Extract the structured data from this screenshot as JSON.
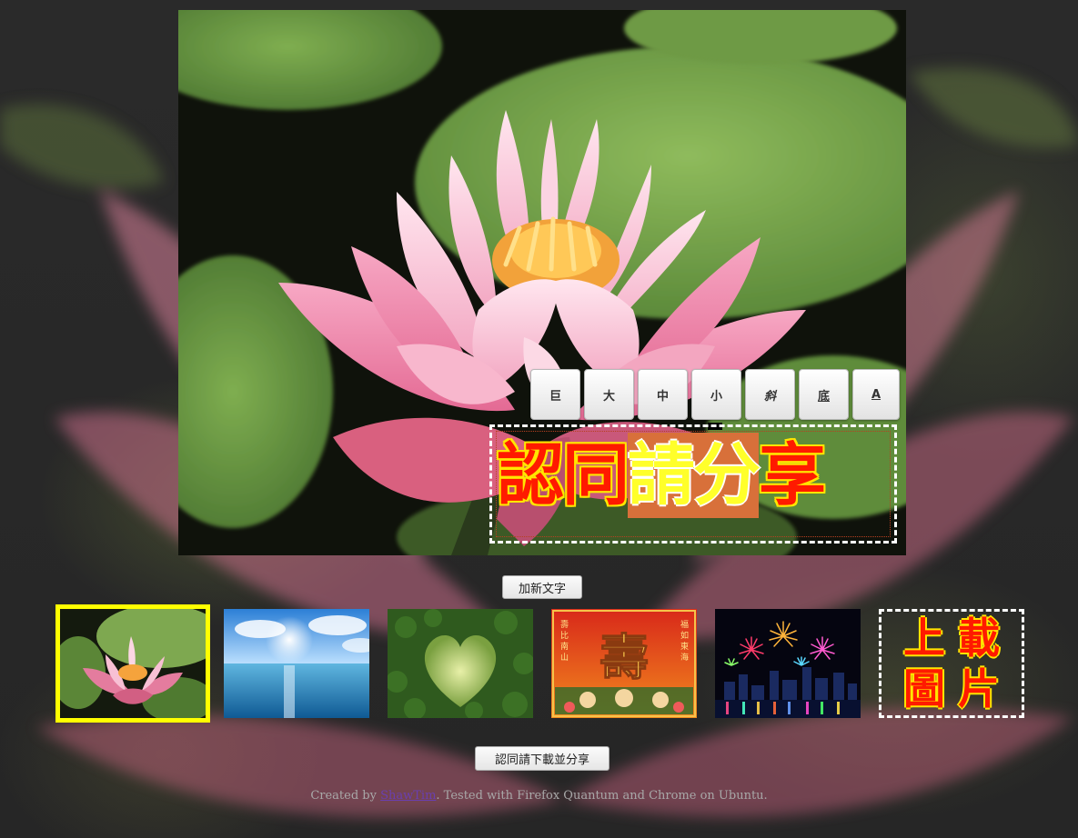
{
  "toolbar": {
    "buttons": [
      {
        "label": "巨",
        "style": "plain"
      },
      {
        "label": "大",
        "style": "plain"
      },
      {
        "label": "中",
        "style": "plain"
      },
      {
        "label": "小",
        "style": "plain"
      },
      {
        "label": "斜",
        "style": "italic"
      },
      {
        "label": "底",
        "style": "underline"
      },
      {
        "label": "A",
        "style": "underline"
      }
    ]
  },
  "overlay_text": {
    "part1": "認同",
    "highlighted": "請分",
    "part3": "享",
    "text_color": "#ff1a00",
    "outline_color": "#ffe600",
    "highlight_bg": "#d8703a",
    "highlight_text_color": "#ffff2a"
  },
  "add_text_label": "加新文字",
  "thumbnails": [
    {
      "name": "thumb-lotus",
      "selected": true
    },
    {
      "name": "thumb-ocean-sky",
      "selected": false
    },
    {
      "name": "thumb-heart-foliage",
      "selected": false
    },
    {
      "name": "thumb-longevity-greeting",
      "selected": false
    },
    {
      "name": "thumb-fireworks-city",
      "selected": false
    }
  ],
  "upload": {
    "line1": "上載",
    "line2": "圖片"
  },
  "download_label": "認同請下載並分享",
  "footer": {
    "prefix": "Created by ",
    "author": "ShawTim",
    "suffix": ". Tested with Firefox Quantum and Chrome on Ubuntu."
  },
  "colors": {
    "selected_border": "#ffff00",
    "page_bg": "#232323",
    "link": "#6a3fb0"
  }
}
